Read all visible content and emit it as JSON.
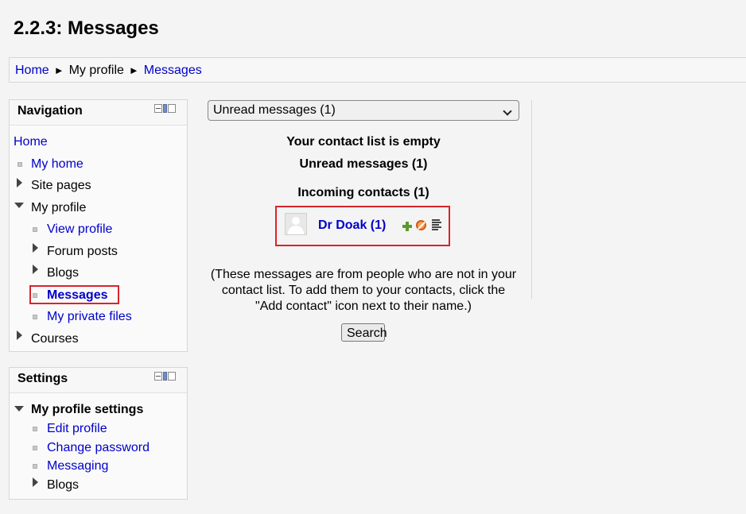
{
  "page": {
    "title": "2.2.3: Messages"
  },
  "breadcrumb": {
    "home": "Home",
    "profile": "My profile",
    "messages": "Messages",
    "separator": "►"
  },
  "navigation": {
    "title": "Navigation",
    "home": "Home",
    "my_home": "My home",
    "site_pages": "Site pages",
    "my_profile": "My profile",
    "view_profile": "View profile",
    "forum_posts": "Forum posts",
    "blogs": "Blogs",
    "messages": "Messages",
    "private_files": "My private files",
    "courses": "Courses"
  },
  "settings": {
    "title": "Settings",
    "profile_settings": "My profile settings",
    "edit_profile": "Edit profile",
    "change_password": "Change password",
    "messaging": "Messaging",
    "blogs": "Blogs"
  },
  "messages": {
    "select_value": "Unread messages (1)",
    "contact_list_status": "Your contact list is empty",
    "unread_heading": "Unread messages (1)",
    "incoming_heading": "Incoming contacts (1)",
    "contact_name": "Dr Doak (1)",
    "info_text": "(These messages are from people who are not in your contact list. To add them to your contacts, click the \"Add contact\" icon next to their name.)",
    "search_label": "Search"
  },
  "colors": {
    "link": "#0000cc",
    "highlight": "#d9242c"
  }
}
